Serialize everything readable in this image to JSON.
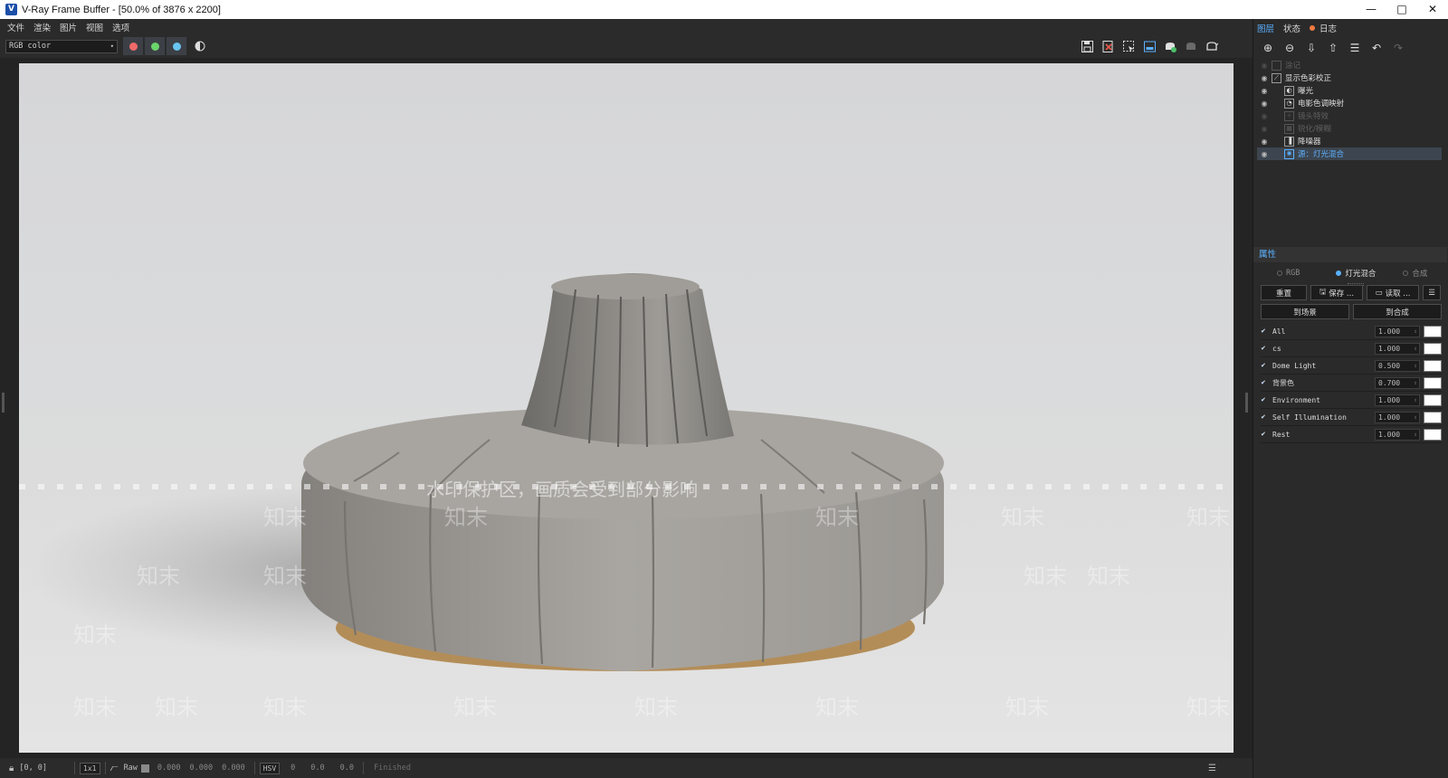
{
  "window": {
    "title": "V-Ray Frame Buffer - [50.0% of 3876 x 2200]",
    "app_icon": "vray-logo-icon",
    "controls": [
      "minimize-icon",
      "maximize-icon",
      "close-icon"
    ],
    "control_glyphs": [
      "—",
      "□",
      "✕"
    ]
  },
  "menu": [
    "文件",
    "渲染",
    "图片",
    "视图",
    "选项"
  ],
  "toolbar": {
    "channel_value": "RGB color",
    "channel_buttons": [
      {
        "name": "red-channel-button",
        "color": "#f06a6a"
      },
      {
        "name": "green-channel-button",
        "color": "#6ad36a"
      },
      {
        "name": "blue-channel-button",
        "color": "#6ac4f0"
      }
    ],
    "right_icons": [
      "save-image-icon",
      "clear-image-icon",
      "region-render-icon",
      "track-mouse-icon",
      "interactive-render-icon",
      "render-icon-disabled",
      "teapot-render-icon"
    ]
  },
  "render": {
    "watermark_main": "水印保护区，画质会受到部分影响",
    "watermark_tile": "知末"
  },
  "status": {
    "coords": "[0, 0]",
    "zoom": "1x1",
    "mode": "Raw",
    "rgb": [
      "0.000",
      "0.000",
      "0.000"
    ],
    "color_space": "HSV",
    "hsv": [
      "0",
      "0.0",
      "0.0"
    ],
    "state": "Finished"
  },
  "panel": {
    "tabs": [
      "图层",
      "状态",
      "日志"
    ],
    "active_tab": "图层",
    "layers": [
      {
        "label": "涂记",
        "state": "disabled",
        "indent": 1
      },
      {
        "label": "显示色彩校正",
        "state": "normal",
        "indent": 1
      },
      {
        "label": "曝光",
        "state": "normal",
        "indent": 2
      },
      {
        "label": "电影色调映射",
        "state": "normal",
        "indent": 2
      },
      {
        "label": "镜头特效",
        "state": "disabled",
        "indent": 2
      },
      {
        "label": "锐化/模糊",
        "state": "disabled",
        "indent": 2
      },
      {
        "label": "降噪器",
        "state": "normal",
        "indent": 2
      },
      {
        "label": "源：灯光混合",
        "state": "selected",
        "indent": 2
      }
    ],
    "properties": {
      "header": "属性",
      "modes": [
        {
          "label": "RGB",
          "active": false
        },
        {
          "label": "灯光混合",
          "active": true
        },
        {
          "label": "合成",
          "active": false
        }
      ],
      "buttons_row1": [
        "重置",
        "保存 ...",
        "读取 ..."
      ],
      "buttons_row2": [
        "到场景",
        "到合成"
      ],
      "mix": [
        {
          "name": "All",
          "value": "1.000",
          "color": "#ffffff"
        },
        {
          "name": "cs",
          "value": "1.000",
          "color": "#ffffff"
        },
        {
          "name": "Dome Light",
          "value": "0.500",
          "color": "#ffffff"
        },
        {
          "name": "背景色",
          "value": "0.700",
          "color": "#ffffff"
        },
        {
          "name": "Environment",
          "value": "1.000",
          "color": "#ffffff"
        },
        {
          "name": "Self Illumination",
          "value": "1.000",
          "color": "#ffffff"
        },
        {
          "name": "Rest",
          "value": "1.000",
          "color": "#ffffff"
        }
      ]
    }
  }
}
